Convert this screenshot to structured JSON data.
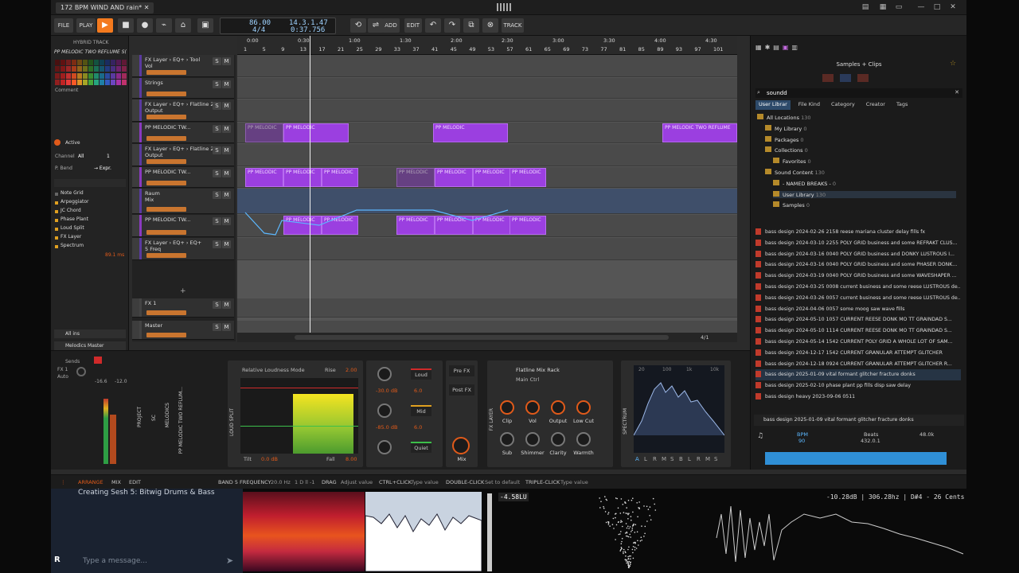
{
  "window": {
    "title": "172 BPM WIND AND rain*"
  },
  "transport": {
    "file": "FILE",
    "play": "PLAY",
    "tempo": "86.00",
    "signature": "4/4",
    "position": "14.3.1.47",
    "time": "0:37.756",
    "add": "ADD",
    "edit": "EDIT",
    "track": "TRACK"
  },
  "inspector": {
    "title": "HYBRID TRACK",
    "preset": "PP MELODIC TWO REFLUME S(",
    "comment": "Comment",
    "active": "Active",
    "channel_label": "Channel",
    "channel_value": "All",
    "channel_num": "1",
    "pbend_label": "P. Bend",
    "pbend_value": "→ Expr.",
    "devices": [
      "Note Grid",
      "Arpeggiator",
      "JC Chord",
      "Phase Plant",
      "Loud Split",
      "FX Layer",
      "Spectrum"
    ],
    "device_value": "89.1 ms",
    "all_ins": "All ins",
    "melodics_master": "Melodics Master",
    "sends": "Sends",
    "fx1": "FX 1",
    "auto": "Auto",
    "meter_a": "-16.6",
    "meter_b": "-12.0",
    "project_label": "PROJECT",
    "sc_label": "SC",
    "melodics_label": "MELODICS",
    "pp_label": "PP MELODIC TWO REFLUM..."
  },
  "tracks": [
    {
      "name": "FX Layer › EQ+ › Tool\nVol"
    },
    {
      "name": "Strings"
    },
    {
      "name": "FX Layer › EQ+ › Flatline 2\nOutput"
    },
    {
      "name": "PP MELODIC TW..."
    },
    {
      "name": "FX Layer › EQ+ › Flatline 2\nOutput"
    },
    {
      "name": "PP MELODIC TW..."
    },
    {
      "name": "Raum\nMix"
    },
    {
      "name": "PP MELODIC TW..."
    },
    {
      "name": "FX Layer › EQ+ › EQ+\n5 Freq"
    },
    {
      "name": "FX 1"
    },
    {
      "name": "Master"
    }
  ],
  "ruler": {
    "times": [
      "0:00",
      "0:30",
      "1:00",
      "1:30",
      "2:00",
      "2:30",
      "3:00",
      "3:30",
      "4:00",
      "4:30"
    ],
    "bars": [
      "1",
      "5",
      "9",
      "13",
      "17",
      "21",
      "25",
      "29",
      "33",
      "37",
      "41",
      "45",
      "49",
      "53",
      "57",
      "61",
      "65",
      "69",
      "73",
      "77",
      "81",
      "85",
      "89",
      "93",
      "97",
      "101"
    ]
  },
  "clips": {
    "label_a": "PP MELODIC",
    "label_b": "PP MELODIC TWO REFLUME"
  },
  "arranger_footer": {
    "zoom": "4/1"
  },
  "devices": {
    "loudsplit": {
      "label": "LOUD SPLIT",
      "mode": "Relative Loudness Mode",
      "rise_label": "Rise",
      "rise": "2.00",
      "tilt_label": "Tilt",
      "tilt": "0.0 dB",
      "fall_label": "Fall",
      "fall": "8.00"
    },
    "bands": [
      {
        "name": "Loud",
        "db": "-30.0 dB",
        "val": "6.0"
      },
      {
        "name": "Mid",
        "db": "-85.0 dB",
        "val": "6.0"
      },
      {
        "name": "Quiet",
        "db": "",
        "val": ""
      }
    ],
    "pre_fx": "Pre FX",
    "post_fx": "Post FX",
    "mix": "Mix",
    "fxlayer": {
      "label": "FX LAYER",
      "title": "Flatline Mix Rack",
      "sub": "Main Ctrl",
      "knobs_top": [
        "Clip",
        "Vol",
        "Output",
        "Low Cut"
      ],
      "knobs_bottom": [
        "Sub",
        "Shimmer",
        "Clarity",
        "Warmth"
      ]
    },
    "spectrum": {
      "label": "SPECTRUM",
      "scale": [
        "20",
        "100",
        "1k",
        "10k"
      ],
      "modes": [
        "A",
        "L",
        "R",
        "M",
        "S",
        "B",
        "L",
        "R",
        "M",
        "S"
      ]
    }
  },
  "browser": {
    "title": "Samples + Clips",
    "search": "soundd",
    "filters": [
      "User Librar",
      "File Kind",
      "Category",
      "Creator",
      "Tags"
    ],
    "locations": [
      {
        "name": "All Locations",
        "count": "130"
      },
      {
        "name": "My Library",
        "count": "0"
      },
      {
        "name": "Packages",
        "count": "0"
      },
      {
        "name": "Collections",
        "count": "0"
      },
      {
        "name": "Favorites",
        "count": "0"
      },
      {
        "name": "Sound Content",
        "count": "130"
      },
      {
        "name": "- NAMED BREAKS -",
        "count": "0"
      },
      {
        "name": "User Library",
        "count": "130"
      },
      {
        "name": "Samples",
        "count": "0"
      }
    ],
    "files": [
      "bass design 2024-02-26 2158 reese mariana cluster delay fills fx",
      "bass design 2024-03-10 2255 POLY GRID business and some REFRAKT CLUS...",
      "bass design 2024-03-16 0040 POLY GRID business and DONKY LUSTROUS I...",
      "bass design 2024-03-16 0040 POLY GRID business and some PHASER DONK...",
      "bass design 2024-03-19 0040 POLY GRID business and some WAVESHAPER ...",
      "bass design 2024-03-25 0008 current business and some reese LUSTROUS de...",
      "bass design 2024-03-26 0057 current business and some reese LUSTROUS de...",
      "bass design 2024-04-06 0057 some moog saw wave fills",
      "bass design 2024-05-10 1057 CURRENT REESE DONK MO TT GRAINDAD S...",
      "bass design 2024-05-10 1114 CURRENT REESE DONK MO TT GRAINDAD S...",
      "bass design 2024-05-14 1542 CURRENT POLY GRID A WHOLE LOT OF SAM...",
      "bass design 2024-12-17 1542 CURRENT GRANULAR ATTEMPT GLITCHER",
      "bass design 2024-12-18 0924 CURRENT GRANULAR ATTEMPT GLITCHER R...",
      "bass design 2025-01-09 vital formant glitcher fracture donks",
      "bass design 2025-02-10 phase plant pp fills disp saw delay",
      "bass design heavy 2023-09-06 0511"
    ],
    "selected": "bass design 2025-01-09 vital formant glitcher fracture donks",
    "bpm_label": "BPM",
    "bpm": "90",
    "beats_label": "Beats",
    "beats": "432.0.1",
    "rate": "48.0k"
  },
  "statusbar": {
    "arrange": "ARRANGE",
    "mix": "MIX",
    "edit": "EDIT",
    "param": "BAND 5 FREQUENCY",
    "param_val": "20.0 Hz",
    "param_extra": "1 D ll -1",
    "drag": "DRAG",
    "drag_hint": "Adjust value",
    "ctrlclick": "CTRL+CLICK",
    "ctrlclick_hint": "Type value",
    "dblclick": "DOUBLE-CLICK",
    "dblclick_hint": "Set to default",
    "tripleclick": "TRIPLE-CLICK",
    "tripleclick_hint": "Type value"
  },
  "stream": {
    "chat_title": "Creating Sesh 5: Bitwig Drums & Bass",
    "chat_placeholder": "Type a message...",
    "level": "-4.58LU",
    "meter_readout": "-10.28dB | 306.28hz | D#4 - 26 Cents"
  }
}
